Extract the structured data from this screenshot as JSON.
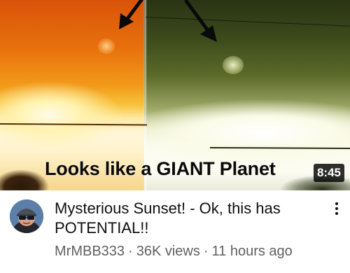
{
  "video": {
    "thumbnail_caption": "Looks like a GIANT Planet",
    "duration": "8:45",
    "title": "Mysterious Sunset! - Ok, this has POTENTIAL!!",
    "channel": "MrMBB333",
    "views": "36K views",
    "age": "11 hours ago",
    "separator": "·"
  },
  "icons": {
    "menu": "more-vert-icon",
    "avatar": "channel-avatar"
  },
  "colors": {
    "title_text": "#0f0f0f",
    "meta_text": "#606060",
    "duration_bg": "#000000"
  }
}
